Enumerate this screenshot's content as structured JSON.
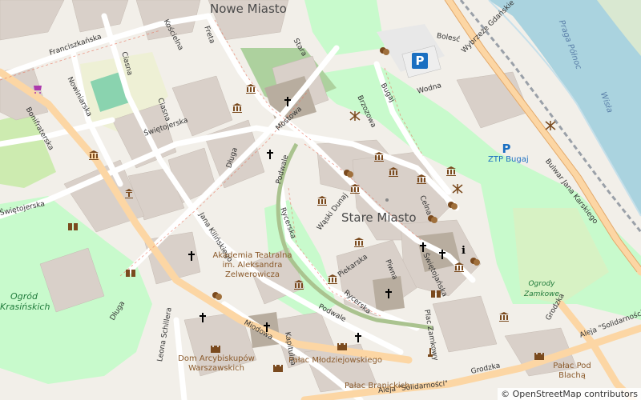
{
  "map": {
    "districts": [
      {
        "name": "Nowe Miasto"
      },
      {
        "name": "Stare Miasto"
      }
    ],
    "streets": [
      "Franciszkańska",
      "Kościelna",
      "Freta",
      "Ciasna",
      "Nowiniarska",
      "Bonifraterska",
      "Ciasna",
      "Świętojerska",
      "Mostowa",
      "Stara",
      "Brzozowa",
      "Bugaj",
      "Bolesć",
      "Wodna",
      "Wybrzeże Gdańskie",
      "Bulwar Jana Karskiego",
      "Celna",
      "Podwale",
      "Rycerska",
      "Wąski Dunaj",
      "Długa",
      "Jana Kilińskiego",
      "Świętojerska",
      "Świętojańska",
      "Piwna",
      "Piekarska",
      "Rycerska",
      "Podwale",
      "Kapitulna",
      "Miodowa",
      "Długa",
      "Leona Schillera",
      "Plac Zamkowy",
      "Grodzka",
      "Grodzka",
      "Aleja \"Solidarności\"",
      "Aleja \"Solidarności\"",
      "Wisła",
      "Praga Północ"
    ],
    "poi_labels": [
      "Akademia Teatralna im. Aleksandra Zelwerowicza",
      "Dom Arcybiskupów Warszawskich",
      "Pałac Młodziejowskiego",
      "Pałac Branickich",
      "Pałac Pod Blachą"
    ],
    "park_labels": [
      "Ogród Krasińskich",
      "Ogrody Zamkowe"
    ],
    "parking_labels": [
      "ZTP Bugaj"
    ],
    "attribution": "© OpenStreetMap contributors",
    "colors": {
      "background": "#f2efe9",
      "building": "#d9d0c9",
      "park": "#c8facc",
      "water": "#aad3df",
      "primary_road": "#fcd6a4",
      "railway": "#9aa0a8",
      "poi_brown": "#7a4a1e",
      "parking": "#1a6fc1"
    }
  }
}
